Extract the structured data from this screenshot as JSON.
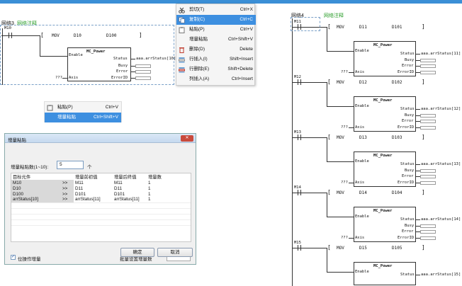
{
  "colors": {
    "accent": "#3b8fd6",
    "menu_sel": "#3d8fe0",
    "green": "#2a9d2a"
  },
  "left_ladder": {
    "network": "网络3",
    "comment": "网络注释",
    "contact": "M10",
    "mov": {
      "op": "MOV",
      "src": "D10",
      "dst": "D100",
      "bracket_open": "[",
      "bracket_close": "]"
    },
    "fb": {
      "name": "MC_Power",
      "enable": "Enable",
      "status": "Status",
      "busy": "Busy",
      "error": "Error",
      "axis": "Axis",
      "errorid": "ErrorID",
      "axis_in": "???",
      "status_out": "aaa.arrStatus[10]"
    }
  },
  "context_menu": {
    "items": [
      {
        "icon": "scissors-icon",
        "label": "剪切(T)",
        "shortcut": "Ctrl+X"
      },
      {
        "icon": "copy-icon",
        "label": "复制(C)",
        "shortcut": "Ctrl+C",
        "selected": true
      },
      {
        "icon": "paste-icon",
        "label": "粘贴(P)",
        "shortcut": "Ctrl+V"
      },
      {
        "icon": "",
        "label": "增量粘贴",
        "shortcut": "Ctrl+Shift+V"
      },
      {
        "icon": "delete-icon",
        "label": "删除(D)",
        "shortcut": "Delete"
      },
      {
        "icon": "insert-row-icon",
        "label": "行插入(I)",
        "shortcut": "Shift+Insert"
      },
      {
        "icon": "delete-row-icon",
        "label": "行删除(E)",
        "shortcut": "Shift+Delete"
      },
      {
        "icon": "",
        "label": "列插入(A)",
        "shortcut": "Ctrl+Insert"
      }
    ]
  },
  "small_menu": {
    "items": [
      {
        "icon": "paste-icon",
        "label": "粘贴(P)",
        "shortcut": "Ctrl+V"
      },
      {
        "label": "增量粘贴",
        "shortcut": "Ctrl+Shift+V",
        "selected": true
      }
    ]
  },
  "dialog": {
    "title": "增量粘贴",
    "close": "✕",
    "count_label": "增量粘贴数(1~10):",
    "count_value": "5",
    "count_unit": "个",
    "headers": [
      "目标元件",
      "",
      "增量前初值",
      "增量后终值",
      "增量数"
    ],
    "rows": [
      [
        "M10",
        ">>",
        "M11",
        "M11",
        "1"
      ],
      [
        "D10",
        ">>",
        "D11",
        "D11",
        "1"
      ],
      [
        "D100",
        ">>",
        "D101",
        "D101",
        "1"
      ],
      [
        "arrStatus[10]",
        ">>",
        "arrStatus[11]",
        "arrStatus[11]",
        "1"
      ]
    ],
    "bit_op_label": "位操作增量",
    "bit_op_checked": "✓",
    "batch_label": "批量设置增量数",
    "ok": "确定",
    "cancel": "取消"
  },
  "right_ladder": {
    "network": "网络4",
    "comment": "网络注释",
    "rungs": [
      {
        "contact": "M11",
        "op": "MOV",
        "src": "D11",
        "dst": "D101",
        "status_out": "aaa.arrStatus[11]"
      },
      {
        "contact": "M12",
        "op": "MOV",
        "src": "D12",
        "dst": "D102",
        "status_out": "aaa.arrStatus[12]"
      },
      {
        "contact": "M13",
        "op": "MOV",
        "src": "D13",
        "dst": "D103",
        "status_out": "aaa.arrStatus[13]"
      },
      {
        "contact": "M14",
        "op": "MOV",
        "src": "D14",
        "dst": "D104",
        "status_out": "aaa.arrStatus[14]"
      },
      {
        "contact": "M15",
        "op": "MOV",
        "src": "D15",
        "dst": "D105",
        "status_out": "aaa.arrStatus[15]"
      }
    ],
    "fb": {
      "name": "MC_Power",
      "enable": "Enable",
      "status": "Status",
      "busy": "Busy",
      "error": "Error",
      "axis": "Axis",
      "errorid": "ErrorID",
      "axis_in": "???"
    }
  }
}
